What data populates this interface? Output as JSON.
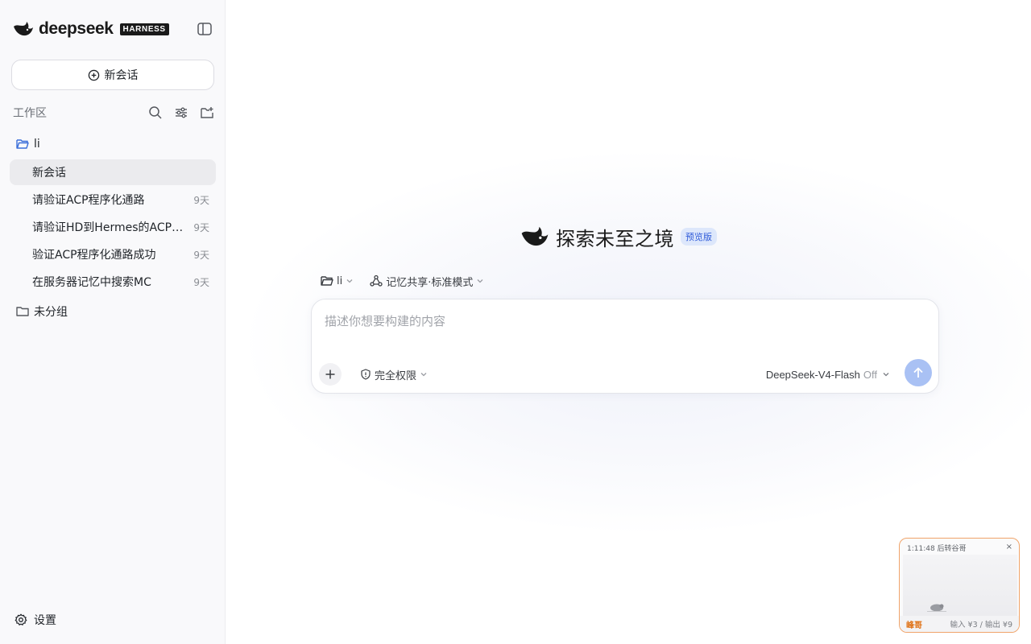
{
  "brand": {
    "wordmark": "deepseek",
    "tag": "HARNESS"
  },
  "sidebar": {
    "new_chat_label": "新会话",
    "workspace_title": "工作区",
    "folder_li": {
      "label": "li",
      "color": "#3b6fd9"
    },
    "chats": [
      {
        "title": "新会话",
        "age": "",
        "active": true
      },
      {
        "title": "请验证ACP程序化通路",
        "age": "9天"
      },
      {
        "title": "请验证HD到Hermes的ACP通路",
        "age": "9天"
      },
      {
        "title": "验证ACP程序化通路成功",
        "age": "9天"
      },
      {
        "title": "在服务器记忆中搜索MC",
        "age": "9天"
      }
    ],
    "folder_ungrouped": {
      "label": "未分组"
    },
    "settings_label": "设置"
  },
  "main": {
    "hero_title": "探索未至之境",
    "hero_badge": "预览版",
    "ctx_folder": "li",
    "ctx_memory": "记忆共享·标准模式",
    "composer": {
      "placeholder": "描述你想要构建的内容",
      "permission": "完全权限",
      "model": "DeepSeek-V4-Flash",
      "model_toggle": "Off"
    }
  },
  "mini_player": {
    "timestamp": "1:11:48 后转谷哥",
    "close_glyph": "×",
    "user": "峰哥",
    "price": "输入 ¥3 / 输出 ¥9"
  },
  "colors": {
    "accent": "#3b6fd9",
    "send_button": "#a9c1f4",
    "badge_bg": "#dde7fb",
    "mini_border": "#f0a46a"
  },
  "icons": [
    "whale-logo-icon",
    "sidebar-toggle-icon",
    "plus-circle-icon",
    "search-icon",
    "filter-icon",
    "new-folder-icon",
    "folder-open-icon",
    "folder-icon",
    "gear-icon",
    "memory-share-icon",
    "chevron-down-icon",
    "plus-icon",
    "shield-icon",
    "arrow-up-icon"
  ]
}
